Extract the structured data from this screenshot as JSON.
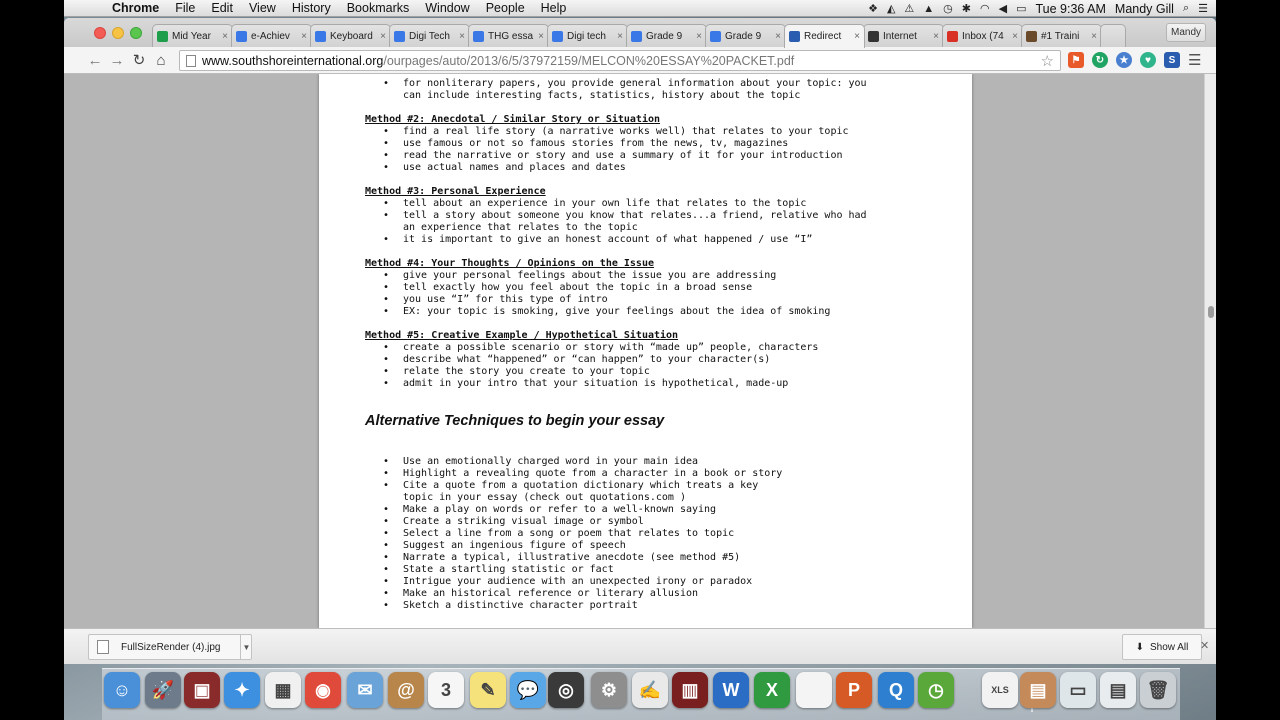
{
  "menubar": {
    "app": "Chrome",
    "items": [
      "File",
      "Edit",
      "View",
      "History",
      "Bookmarks",
      "Window",
      "People",
      "Help"
    ],
    "clock": "Tue 9:36 AM",
    "user": "Mandy Gill"
  },
  "tabs": [
    {
      "label": "Mid Year",
      "icon": "spreadsheet-icon",
      "color": "#1e9e4a"
    },
    {
      "label": "e-Achiev",
      "icon": "doc-icon",
      "color": "#3b78e7"
    },
    {
      "label": "Keyboard",
      "icon": "doc-icon",
      "color": "#3b78e7"
    },
    {
      "label": "Digi Tech",
      "icon": "doc-icon",
      "color": "#3b78e7"
    },
    {
      "label": "THG essa",
      "icon": "doc-icon",
      "color": "#3b78e7"
    },
    {
      "label": "Digi tech",
      "icon": "doc-icon",
      "color": "#3b78e7"
    },
    {
      "label": "Grade 9",
      "icon": "doc-icon",
      "color": "#3b78e7"
    },
    {
      "label": "Grade 9",
      "icon": "doc-icon",
      "color": "#3b78e7"
    },
    {
      "label": "Redirect",
      "icon": "s-icon",
      "color": "#2a5db0",
      "active": true
    },
    {
      "label": "Internet",
      "icon": "bb-icon",
      "color": "#333333"
    },
    {
      "label": "Inbox (74",
      "icon": "gmail-icon",
      "color": "#d93025"
    },
    {
      "label": "#1 Traini",
      "icon": "user-icon",
      "color": "#6b4a2b"
    }
  ],
  "profile": "Mandy",
  "url": {
    "host": "www.southshoreinternational.org",
    "path": "/ourpages/auto/2013/6/5/37972159/MELCON%20ESSAY%20PACKET.pdf"
  },
  "document": {
    "intro_lines": [
      "for nonliterary papers, you provide general information about your topic: you",
      "can include interesting facts, statistics, history about the topic"
    ],
    "methods": [
      {
        "heading": "Method #2: Anecdotal / Similar Story or Situation",
        "bullets": [
          [
            "find a real life story (a narrative works well) that relates to your topic"
          ],
          [
            "use famous or not so famous stories from the news, tv, magazines"
          ],
          [
            "read the narrative or story and use a summary of it for your introduction"
          ],
          [
            "use actual names and places and dates"
          ]
        ]
      },
      {
        "heading": "Method #3: Personal Experience",
        "bullets": [
          [
            "tell about an experience in your own life that relates to the topic"
          ],
          [
            "tell a story about someone you know that relates...a friend, relative who had",
            "an experience that relates to the topic"
          ],
          [
            "it is important to give an honest account of what happened / use “I”"
          ]
        ]
      },
      {
        "heading": "Method #4: Your Thoughts / Opinions on the Issue",
        "bullets": [
          [
            "give your personal feelings about the issue you are addressing"
          ],
          [
            "tell exactly how you feel about the topic in a broad sense"
          ],
          [
            "you use “I” for this type of intro"
          ],
          [
            "EX: your topic is smoking, give your feelings about the idea of smoking"
          ]
        ]
      },
      {
        "heading": "Method #5: Creative Example / Hypothetical Situation",
        "bullets": [
          [
            "create a possible scenario or story with “made up” people, characters"
          ],
          [
            "describe what “happened” or “can happen” to your character(s)"
          ],
          [
            "relate the story you create to your topic"
          ],
          [
            "admit in your intro that your situation is hypothetical, made-up"
          ]
        ]
      }
    ],
    "alt_heading": "Alternative Techniques to begin your essay",
    "alt_bullets": [
      [
        "Use an emotionally charged word in your main idea"
      ],
      [
        "Highlight a revealing quote from a character in a book or story"
      ],
      [
        "Cite a quote from a quotation dictionary which treats a key",
        "topic in your essay (check out quotations.com )"
      ],
      [
        "Make a play on words or refer to a well-known saying"
      ],
      [
        "Create a striking visual image or symbol"
      ],
      [
        "Select a line from a song or poem that relates to topic"
      ],
      [
        "Suggest an ingenious figure of speech"
      ],
      [
        "Narrate a typical, illustrative anecdote (see method #5)"
      ],
      [
        "State a startling statistic or fact"
      ],
      [
        "Intrigue your audience with an unexpected irony or paradox"
      ],
      [
        "Make an historical reference or literary allusion"
      ],
      [
        "Sketch a distinctive character portrait"
      ]
    ]
  },
  "download": {
    "filename": "FullSizeRender (4).jpg",
    "show_all": "Show All"
  },
  "dock": [
    {
      "name": "finder-icon",
      "color": "#4a90d9",
      "glyph": "☺"
    },
    {
      "name": "launchpad-icon",
      "color": "#6d7b8a",
      "glyph": "🚀"
    },
    {
      "name": "photo-booth-icon",
      "color": "#8a2b2b",
      "glyph": "▣"
    },
    {
      "name": "safari-icon",
      "color": "#3d8fe0",
      "glyph": "✦"
    },
    {
      "name": "app-grid-icon",
      "color": "#f0f0f0",
      "glyph": "▦"
    },
    {
      "name": "chrome-icon",
      "color": "#e04a3a",
      "glyph": "◉"
    },
    {
      "name": "mail-icon",
      "color": "#6aa3d8",
      "glyph": "✉"
    },
    {
      "name": "contacts-icon",
      "color": "#b8864a",
      "glyph": "@"
    },
    {
      "name": "calendar-icon",
      "color": "#f6f6f6",
      "glyph": "3"
    },
    {
      "name": "notes-icon",
      "color": "#f5e27a",
      "glyph": "✎"
    },
    {
      "name": "messages-icon",
      "color": "#5aa7e8",
      "glyph": "💬"
    },
    {
      "name": "facetime-icon",
      "color": "#3a3a3a",
      "glyph": "◎"
    },
    {
      "name": "system-preferences-icon",
      "color": "#8e8e8e",
      "glyph": "⚙"
    },
    {
      "name": "textedit-icon",
      "color": "#e9e9e9",
      "glyph": "✍"
    },
    {
      "name": "photo-strip-icon",
      "color": "#7a1f1f",
      "glyph": "▥"
    },
    {
      "name": "word-icon",
      "color": "#2b6cc4",
      "glyph": "W"
    },
    {
      "name": "excel-icon",
      "color": "#2f9a3f",
      "glyph": "X"
    },
    {
      "name": "blank-document-icon",
      "color": "#f4f4f4",
      "glyph": ""
    },
    {
      "name": "powerpoint-icon",
      "color": "#d65a25",
      "glyph": "P"
    },
    {
      "name": "quicktime-icon",
      "color": "#2e7fd0",
      "glyph": "Q"
    },
    {
      "name": "clock-icon",
      "color": "#5aa83a",
      "glyph": "◷"
    },
    {
      "name": "xls-file-icon",
      "color": "#f2f2f2",
      "glyph": "XLS"
    },
    {
      "name": "photo-stack-icon",
      "color": "#c58a5a",
      "glyph": "▤"
    },
    {
      "name": "screenshot-icon",
      "color": "#dfe6ea",
      "glyph": "▭"
    },
    {
      "name": "downloads-stack-icon",
      "color": "#e8ecef",
      "glyph": "▤"
    },
    {
      "name": "trash-icon",
      "color": "#c9cfd3",
      "glyph": "🗑"
    }
  ]
}
